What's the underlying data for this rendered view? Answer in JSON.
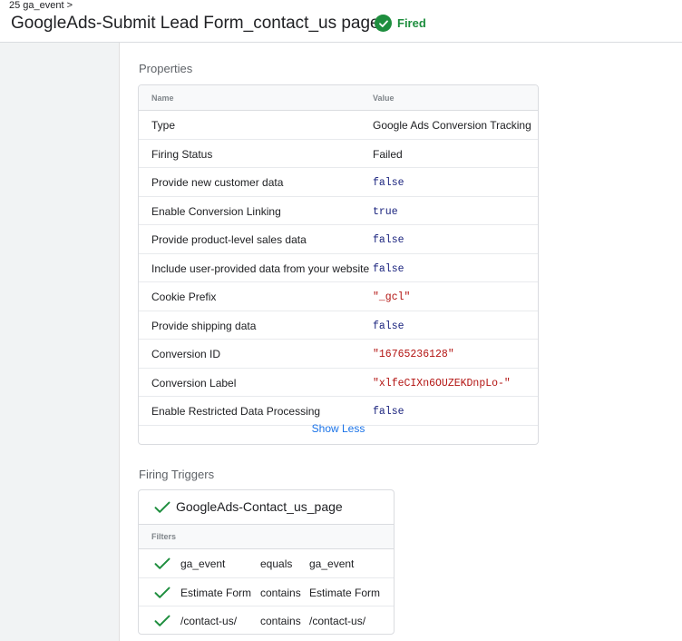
{
  "header": {
    "breadcrumb": "25 ga_event >",
    "title": "GoogleAds-Submit Lead Form_contact_us page",
    "status": "Fired",
    "status_icon": "check-circle-icon"
  },
  "colors": {
    "success": "#1e8e3e",
    "link": "#1a73e8",
    "bool_value": "#1a237e",
    "string_value": "#b31412"
  },
  "properties": {
    "section_title": "Properties",
    "col_name": "Name",
    "col_value": "Value",
    "rows": [
      {
        "name": "Type",
        "value": "Google Ads Conversion Tracking"
      },
      {
        "name": "Firing Status",
        "value": "Failed"
      },
      {
        "name": "Provide new customer data",
        "value": "false"
      },
      {
        "name": "Enable Conversion Linking",
        "value": "true"
      },
      {
        "name": "Provide product-level sales data",
        "value": "false"
      },
      {
        "name": "Include user-provided data from your website",
        "value": "false"
      },
      {
        "name": "Cookie Prefix",
        "value": "\"_gcl\""
      },
      {
        "name": "Provide shipping data",
        "value": "false"
      },
      {
        "name": "Conversion ID",
        "value": "\"16765236128\""
      },
      {
        "name": "Conversion Label",
        "value": "\"xlfeCIXn6OUZEKDnpLo-\""
      },
      {
        "name": "Enable Restricted Data Processing",
        "value": "false"
      }
    ],
    "show_less": "Show Less"
  },
  "triggers": {
    "section_title": "Firing Triggers",
    "trigger_name": "GoogleAds-Contact_us_page",
    "filters_label": "Filters",
    "filters": [
      {
        "variable": "ga_event",
        "operator": "equals",
        "value": "ga_event"
      },
      {
        "variable": "Estimate Form",
        "operator": "contains",
        "value": "Estimate Form"
      },
      {
        "variable": "/contact-us/",
        "operator": "contains",
        "value": "/contact-us/"
      }
    ]
  }
}
